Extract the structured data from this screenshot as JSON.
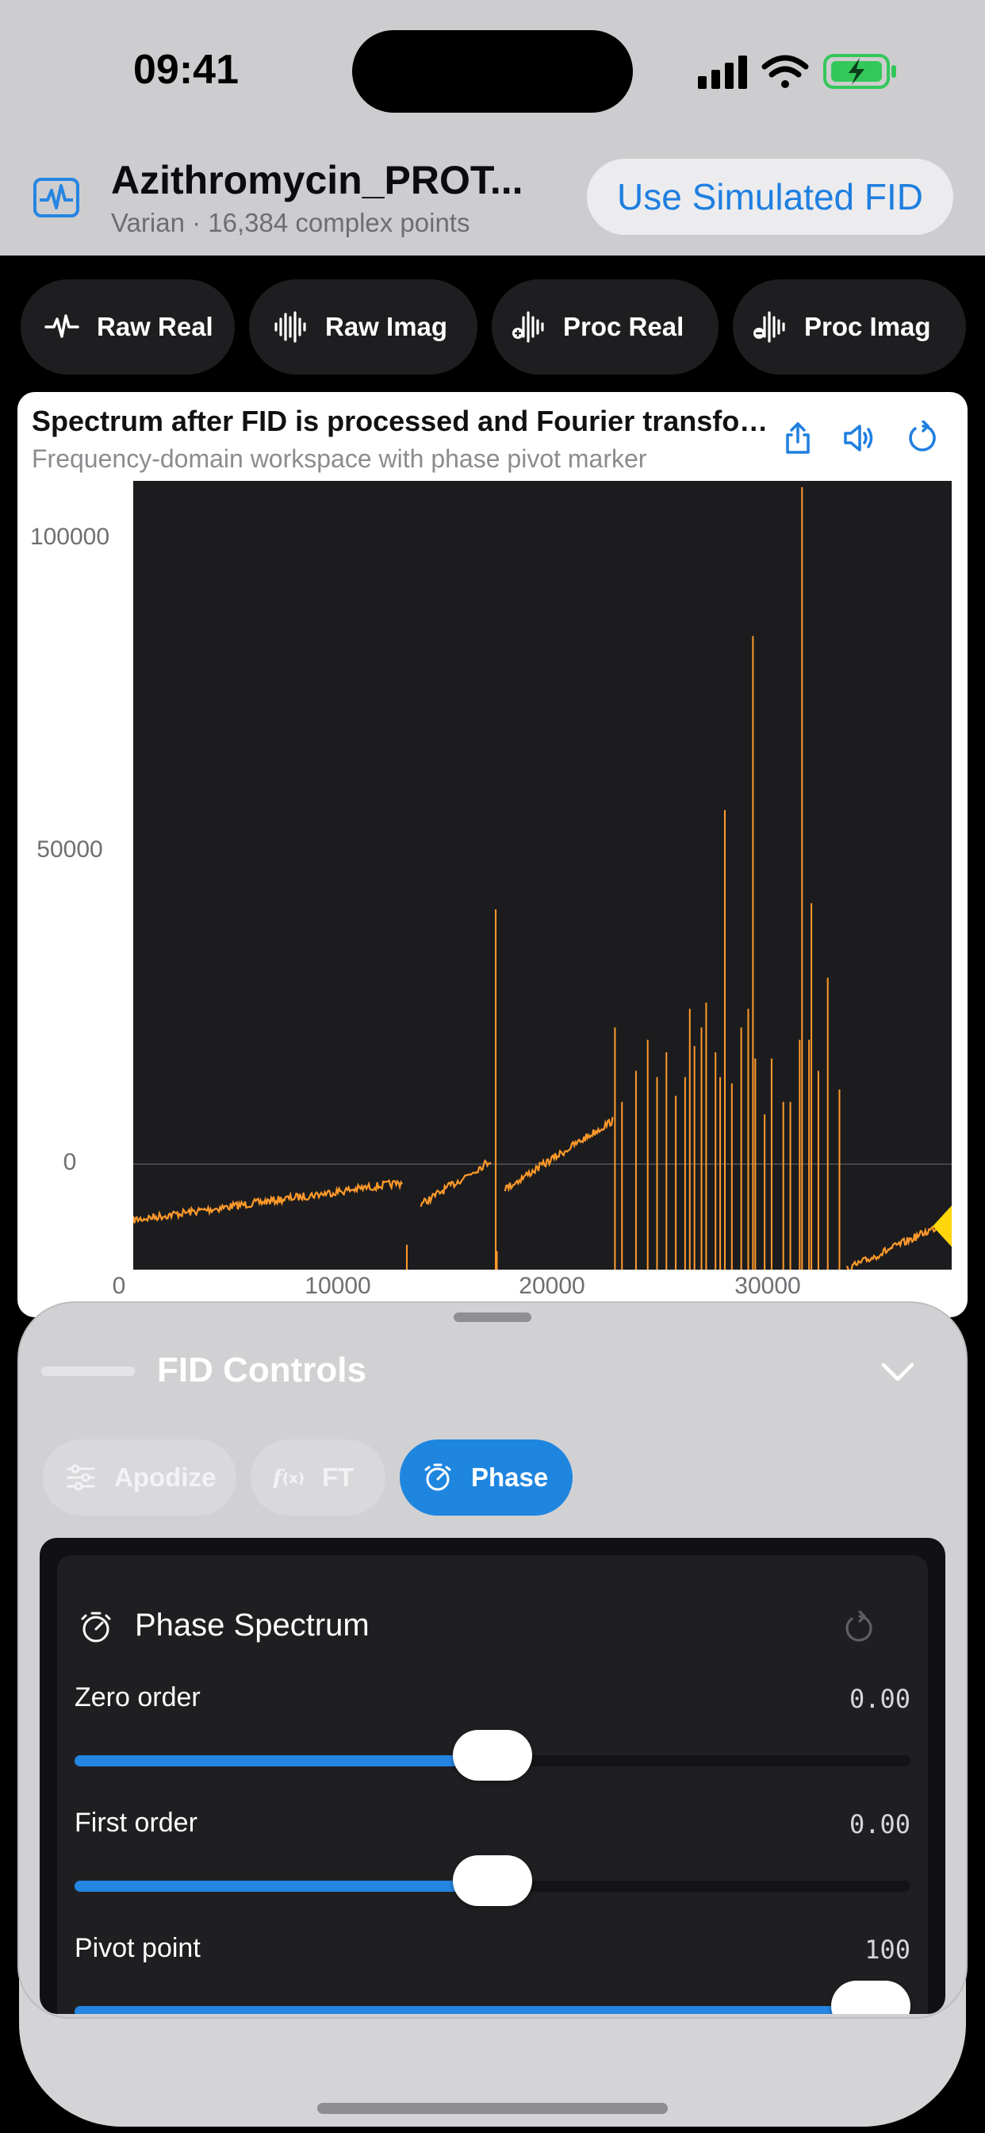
{
  "status": {
    "time": "09:41"
  },
  "header": {
    "file_title": "Azithromycin_PROT...",
    "file_subtitle": "Varian · 16,384 complex points",
    "simulate_label": "Use Simulated FID"
  },
  "modes": [
    {
      "label": "Raw Real",
      "icon": "pulse-icon"
    },
    {
      "label": "Raw Imag",
      "icon": "waveform-icon"
    },
    {
      "label": "Proc Real",
      "icon": "waveform-plus-icon"
    },
    {
      "label": "Proc Imag",
      "icon": "waveform-minus-icon"
    }
  ],
  "spectrum": {
    "title": "Spectrum after FID is processed and Fourier transformed",
    "subtitle": "Frequency-domain workspace with phase pivot marker",
    "actions": [
      "share-icon",
      "speaker-icon",
      "reset-icon"
    ]
  },
  "chart_data": {
    "type": "line",
    "title": "Spectrum after FID is processed and Fourier transformed",
    "xlabel": "",
    "ylabel": "",
    "xlim": [
      -2000,
      33000
    ],
    "ylim": [
      -17000,
      110000
    ],
    "x_ticks": [
      "0",
      "10000",
      "20000",
      "30000"
    ],
    "y_ticks": [
      "0",
      "50000",
      "100000"
    ],
    "grid": "zero line only",
    "series_color": "#ff9a2a",
    "background": "#1c1c1e",
    "baseline_segments": [
      {
        "x": [
          -2000,
          9500
        ],
        "y": [
          -9000,
          -3000
        ]
      },
      {
        "x": [
          10300,
          13300
        ],
        "y": [
          -6500,
          600
        ]
      },
      {
        "x": [
          13900,
          18500
        ],
        "y": [
          -4000,
          7000
        ]
      },
      {
        "x": [
          28500,
          33000
        ],
        "y": [
          -17000,
          -9000
        ]
      }
    ],
    "peaks": [
      [
        9700,
        -13000
      ],
      [
        13500,
        41000
      ],
      [
        13550,
        -14000
      ],
      [
        18600,
        22000
      ],
      [
        18900,
        10000
      ],
      [
        19500,
        15000
      ],
      [
        20000,
        20000
      ],
      [
        20400,
        14000
      ],
      [
        20800,
        18000
      ],
      [
        21200,
        11000
      ],
      [
        21600,
        14000
      ],
      [
        21800,
        25000
      ],
      [
        22000,
        19000
      ],
      [
        22300,
        22000
      ],
      [
        22500,
        26000
      ],
      [
        22900,
        18000
      ],
      [
        23100,
        14000
      ],
      [
        23300,
        57000
      ],
      [
        23600,
        13000
      ],
      [
        24000,
        22000
      ],
      [
        24300,
        25000
      ],
      [
        24500,
        85000
      ],
      [
        24600,
        17000
      ],
      [
        25000,
        8000
      ],
      [
        25300,
        17000
      ],
      [
        25800,
        10000
      ],
      [
        26100,
        10000
      ],
      [
        26500,
        20000
      ],
      [
        26600,
        109000
      ],
      [
        26900,
        20000
      ],
      [
        27000,
        42000
      ],
      [
        27300,
        15000
      ],
      [
        27700,
        30000
      ],
      [
        28200,
        12000
      ]
    ],
    "pivot_marker": {
      "x": 32800,
      "y": -10000,
      "color": "#ffd60a"
    }
  },
  "sheet": {
    "title": "FID Controls",
    "tabs": [
      {
        "label": "Apodize",
        "icon": "sliders-icon",
        "active": false
      },
      {
        "label": "FT",
        "icon": "function-icon",
        "active": false
      },
      {
        "label": "Phase",
        "icon": "timer-icon",
        "active": true
      }
    ]
  },
  "phase": {
    "title": "Phase Spectrum",
    "sliders": [
      {
        "label": "Zero order",
        "value": "0.00",
        "fraction": 0.5
      },
      {
        "label": "First order",
        "value": "0.00",
        "fraction": 0.5
      },
      {
        "label": "Pivot point",
        "value": "100",
        "fraction": 1.0
      }
    ]
  },
  "colors": {
    "accent": "#2585e2",
    "spectrum_line": "#ff9a2a",
    "pivot": "#ffd60a",
    "battery": "#34c759"
  }
}
